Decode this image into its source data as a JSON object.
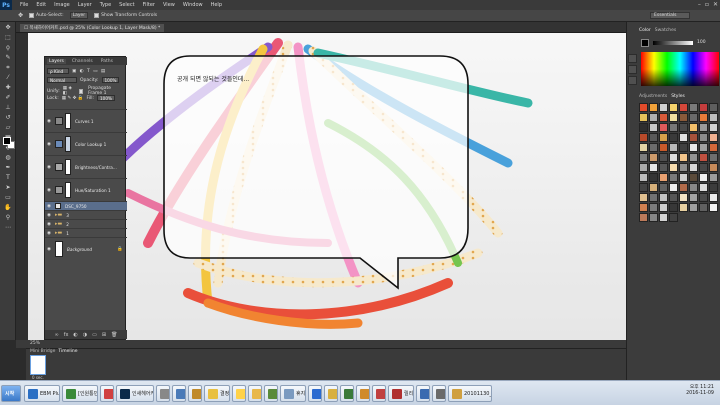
{
  "app": {
    "logo": "Ps"
  },
  "menu": [
    "File",
    "Edit",
    "Image",
    "Layer",
    "Type",
    "Select",
    "Filter",
    "View",
    "Window",
    "Help"
  ],
  "window_controls": [
    "–",
    "▫",
    "✕"
  ],
  "options_bar": {
    "auto_select": "Auto-Select:",
    "auto_select_value": "Layer",
    "transform": "Show Transform Controls",
    "workspace": "Essentials"
  },
  "document": {
    "tab_title": "☐ 목새하이어커트.psd @ 25% (Color Lookup 1, Layer Mask/8) *"
  },
  "status": {
    "zoom": "25%"
  },
  "timeline": {
    "tabs": [
      "Mini Bridge",
      "Timeline"
    ],
    "frame_label": "0 sec."
  },
  "layers_panel": {
    "tabs": [
      "Layers",
      "Channels",
      "Paths"
    ],
    "kind": "ρ Kind",
    "blend_mode": "Normal",
    "opacity_label": "Opacity:",
    "opacity_value": "100%",
    "unify_label": "Unify:",
    "propagate_label": "Propagate Frame 1",
    "lock_label": "Lock:",
    "fill_label": "Fill:",
    "fill_value": "100%",
    "layers": [
      {
        "name": "Curves 1",
        "tall": true,
        "selected": false,
        "type": "adj"
      },
      {
        "name": "Color Lookup 1",
        "tall": true,
        "selected": false,
        "type": "adj"
      },
      {
        "name": "Brightness/Contra...",
        "tall": true,
        "selected": false,
        "type": "adj"
      },
      {
        "name": "Hue/Saturation 1",
        "tall": true,
        "selected": false,
        "type": "adj"
      },
      {
        "name": "DSC_9750",
        "tall": false,
        "selected": true,
        "type": "smart"
      },
      {
        "name": "3",
        "tall": false,
        "selected": false,
        "type": "folder"
      },
      {
        "name": "2",
        "tall": false,
        "selected": false,
        "type": "folder"
      },
      {
        "name": "1",
        "tall": false,
        "selected": false,
        "type": "folder"
      },
      {
        "name": "Background",
        "tall": true,
        "selected": false,
        "type": "bg"
      }
    ],
    "footer_icons": [
      "∞",
      "fx",
      "◐",
      "◑",
      "▭",
      "⊞",
      "🗑"
    ]
  },
  "right_panels": {
    "color_tabs": [
      "Color",
      "Swatches"
    ],
    "color_value": "100",
    "adj_tabs": [
      "Adjustments",
      "Styles"
    ],
    "style_colors": [
      "#e24b2b",
      "#f2a23a",
      "#cfcfcf",
      "#f6d36b",
      "#d4473a",
      "#7a7a7a",
      "#c43d3d",
      "#5e5e5e",
      "#e6c15a",
      "#b0b0b0",
      "#d85a3a",
      "#f0e0a0",
      "#8a5a3a",
      "#6a6a6a",
      "#e87b3a",
      "#bdbdbd",
      "#2e2e2e",
      "#c9c9c9",
      "#e05a5a",
      "#777777",
      "#4a4a4a",
      "#f3c06a",
      "#9a9a9a",
      "#d0d0d0",
      "#b84a2a",
      "#5a5a5a",
      "#d8a04a",
      "#3a3a3a",
      "#e2e2e2",
      "#a6523a",
      "#8c8c8c",
      "#f0b090",
      "#e4d4a4",
      "#6c6c6c",
      "#c85a2a",
      "#b8b8b8",
      "#404040",
      "#e8e8e8",
      "#a0a0a0",
      "#d4683a",
      "#7e7e7e",
      "#cc9a6a",
      "#505050",
      "#dddddd",
      "#f2c48a",
      "#949494",
      "#c05040",
      "#6e6e6e",
      "#aaaaaa",
      "#e6e6e6",
      "#585858",
      "#f6dcae",
      "#8e8e8e",
      "#d8d8d8",
      "#484848",
      "#c68a5a",
      "#bababa",
      "#343434",
      "#e8a070",
      "#7a7a7a",
      "#cfcfcf",
      "#5a4a3a",
      "#f0f0f0",
      "#9c9c9c",
      "#444444",
      "#d6b07a",
      "#626262",
      "#eeeeee",
      "#b06a4a",
      "#888888",
      "#dcdcdc",
      "#3c3c3c",
      "#e0c090",
      "#727272",
      "#c2c2c2",
      "#565656",
      "#f4e4c4",
      "#a2a2a2",
      "#4c4c4c",
      "#eaeaea",
      "#d08050",
      "#7c7c7c",
      "#cccccc",
      "#383838",
      "#e8d0a0",
      "#9e9e9e",
      "#606060",
      "#f2f2f2",
      "#bc7a5a",
      "#868686",
      "#d2d2d2",
      "#424242"
    ]
  },
  "canvas": {
    "bubble_text": "공개 되면 않되는 것들인데..."
  },
  "taskbar": {
    "start_label": "시작",
    "items": [
      {
        "label": "EBM Plus - K...",
        "color": "#2b6fc4"
      },
      {
        "label": "[인원통민간인...",
        "color": "#3a8a3a"
      },
      {
        "label": "",
        "color": "#d04040"
      },
      {
        "label": "인새헤어커트...",
        "color": "#0b2a4a"
      },
      {
        "label": "",
        "color": "#888888"
      },
      {
        "label": "",
        "color": "#4a7ab8"
      },
      {
        "label": "",
        "color": "#c08a2a"
      },
      {
        "label": "결정지",
        "color": "#e8c040"
      },
      {
        "label": "",
        "color": "#ffd24a"
      },
      {
        "label": "",
        "color": "#e8b84a"
      },
      {
        "label": "",
        "color": "#5a8a3a"
      },
      {
        "label": "휴지통",
        "color": "#7a9ac0"
      },
      {
        "label": "",
        "color": "#2a6ad0"
      },
      {
        "label": "",
        "color": "#d8b040"
      },
      {
        "label": "",
        "color": "#3a7a3a"
      },
      {
        "label": "",
        "color": "#d08a2a"
      },
      {
        "label": "",
        "color": "#c04040"
      },
      {
        "label": "릴리퍼",
        "color": "#b03030"
      },
      {
        "label": "",
        "color": "#3a6ab0"
      },
      {
        "label": "",
        "color": "#6a6a6a"
      },
      {
        "label": "20101130_1000...",
        "color": "#d0a040"
      }
    ],
    "clock_time": "오후 11:21",
    "clock_date": "2016-11-09"
  },
  "colors": {
    "ps_bg": "#2b2b2b",
    "selection_blue": "#5a6e8c",
    "accent": "#5fb3ff"
  }
}
